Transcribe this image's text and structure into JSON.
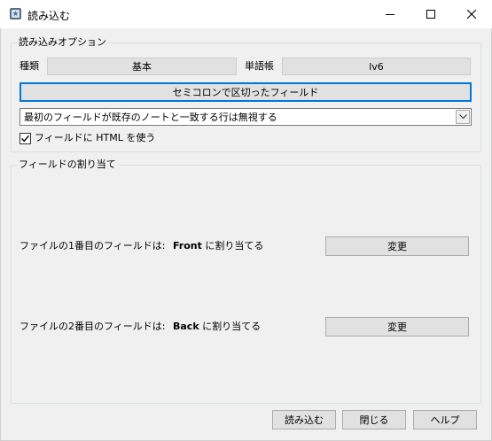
{
  "window": {
    "title": "読み込む",
    "icon": "anki-app-icon"
  },
  "options": {
    "group_title": "読み込みオプション",
    "type_label": "種類",
    "type_value": "基本",
    "deck_label": "単語帳",
    "deck_value": "lv6",
    "separator_button": "セミコロンで区切ったフィールド",
    "duplicate_select": "最初のフィールドが既存のノートと一致する行は無視する",
    "html_checkbox_label": "フィールドに HTML を使う",
    "html_checked": true
  },
  "mapping": {
    "group_title": "フィールドの割り当て",
    "rows": [
      {
        "source": "ファイルの1番目のフィールドは:",
        "target": "Front",
        "suffix": "に割り当てる",
        "change_label": "変更"
      },
      {
        "source": "ファイルの2番目のフィールドは:",
        "target": "Back",
        "suffix": "に割り当てる",
        "change_label": "変更"
      }
    ]
  },
  "footer": {
    "import_label": "読み込む",
    "close_label": "閉じる",
    "help_label": "ヘルプ"
  }
}
